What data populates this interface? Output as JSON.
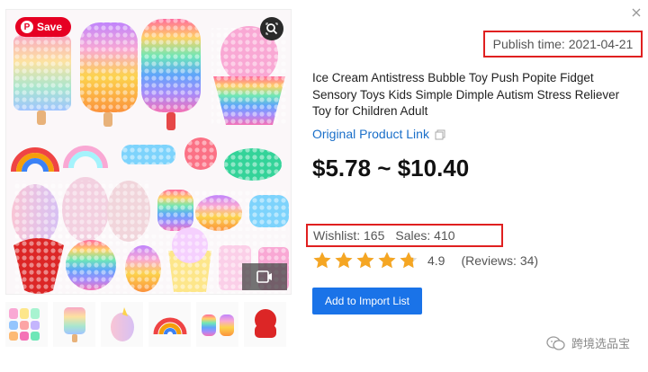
{
  "gallery": {
    "save_label": "Save",
    "pin_glyph": "P",
    "main_image_icon": "popit-toys-photo",
    "thumbnails": [
      {
        "icon": "thumb-assorted-popits"
      },
      {
        "icon": "thumb-popsicle-popit"
      },
      {
        "icon": "thumb-unicorn-popit"
      },
      {
        "icon": "thumb-rainbow-popit"
      },
      {
        "icon": "thumb-bear-popit"
      },
      {
        "icon": "thumb-octopus-popit"
      }
    ]
  },
  "product": {
    "publish_time": "Publish time: 2021-04-21",
    "title": "Ice Cream Antistress Bubble Toy Push Popite Fidget Sensory Toys Kids Simple Dimple Autism Stress Reliever Toy for Children Adult",
    "original_link_label": "Original Product Link",
    "price": "$5.78 ~ $10.40",
    "wishlist": "Wishlist: 165",
    "sales": "Sales: 410",
    "rating_value": "4.9",
    "rating_stars": 4.9,
    "reviews": "(Reviews: 34)",
    "import_button": "Add to Import List"
  },
  "watermark": {
    "text": "跨境选品宝"
  },
  "colors": {
    "accent_blue": "#1a73e8",
    "link_blue": "#1a6fc9",
    "highlight_red": "#e02020",
    "star_gold": "#f5a623",
    "pinterest_red": "#e60023"
  }
}
